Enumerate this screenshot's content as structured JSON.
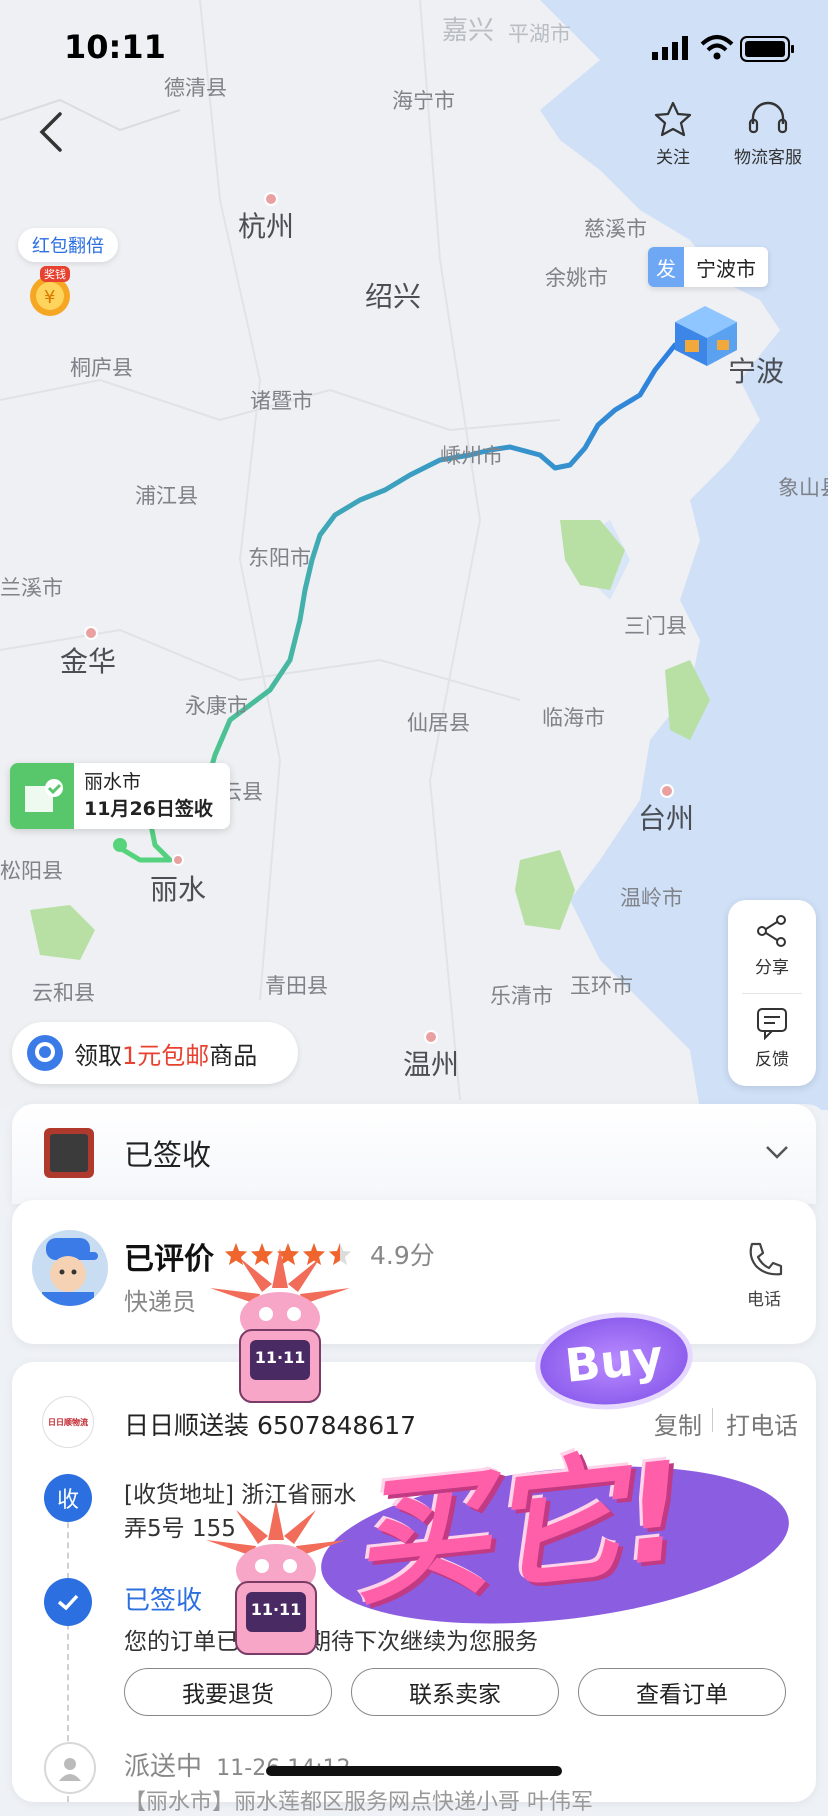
{
  "status_bar": {
    "time": "10:11"
  },
  "top": {
    "follow_label": "关注",
    "service_label": "物流客服",
    "red_packet_label": "红包翻倍",
    "coin_badge": "奖钱"
  },
  "map": {
    "cities": {
      "deqing": "德清县",
      "haining": "海宁市",
      "hangzhou": "杭州",
      "cixi": "慈溪市",
      "shaoxing": "绍兴",
      "yuyao": "余姚市",
      "tonglu": "桐庐县",
      "zhuji": "诸暨市",
      "ningbo": "宁波",
      "shengzhou": "嵊州市",
      "pujiang": "浦江县",
      "xiangshan": "象山县",
      "dongyang": "东阳市",
      "lanxi": "兰溪市",
      "sanmen": "三门县",
      "jinhua": "金华",
      "yongkang": "永康市",
      "xianju": "仙居县",
      "linhai": "临海市",
      "jinyun": "缙云县",
      "taizhou": "台州",
      "songyang": "松阳县",
      "lishui": "丽水",
      "wenling": "温岭市",
      "yunhe": "云和县",
      "qingtian": "青田县",
      "yueqing": "乐清市",
      "yuhuan": "玉环市",
      "wenzhou": "温州",
      "jiaxing": "嘉兴",
      "pinghu": "平湖市"
    },
    "origin_tag": "发",
    "origin_city": "宁波市",
    "dest_city": "丽水市",
    "dest_status": "11月26日签收"
  },
  "promo": {
    "prefix": "领取",
    "highlight": "1元包邮",
    "suffix": "商品"
  },
  "side": {
    "share": "分享",
    "feedback": "反馈"
  },
  "package": {
    "status": "已签收"
  },
  "courier": {
    "rated": "已评价",
    "score": "4.9分",
    "role": "快递员",
    "phone": "电话",
    "rating": 4.5
  },
  "tracking": {
    "company_logo": "日日顺物流",
    "company_no": "日日顺送装 6507848617",
    "copy": "复制",
    "call": "打电话",
    "receive_badge": "收",
    "address_line1": "[收货地址] 浙江省丽水",
    "address_line2": "弄5号 155",
    "signed_title": "已签收",
    "signed_desc": "您的订单已签收，期待下次继续为您服务",
    "btn_return": "我要退货",
    "btn_seller": "联系卖家",
    "btn_order": "查看订单",
    "delivering_title": "派送中",
    "delivering_time": "11-26 14:12",
    "delivering_desc": "【丽水市】丽水莲都区服务网点快递小哥 叶伟军"
  },
  "overlay": {
    "buy": "Buy",
    "big_text": "买它!",
    "robot_text": "11·11"
  },
  "colors": {
    "primary": "#2b6fe0",
    "green": "#58c66b",
    "route_teal": "#3fb3a0",
    "route_blue": "#2d7fe0",
    "red": "#e8412f",
    "star": "#f0642d"
  }
}
